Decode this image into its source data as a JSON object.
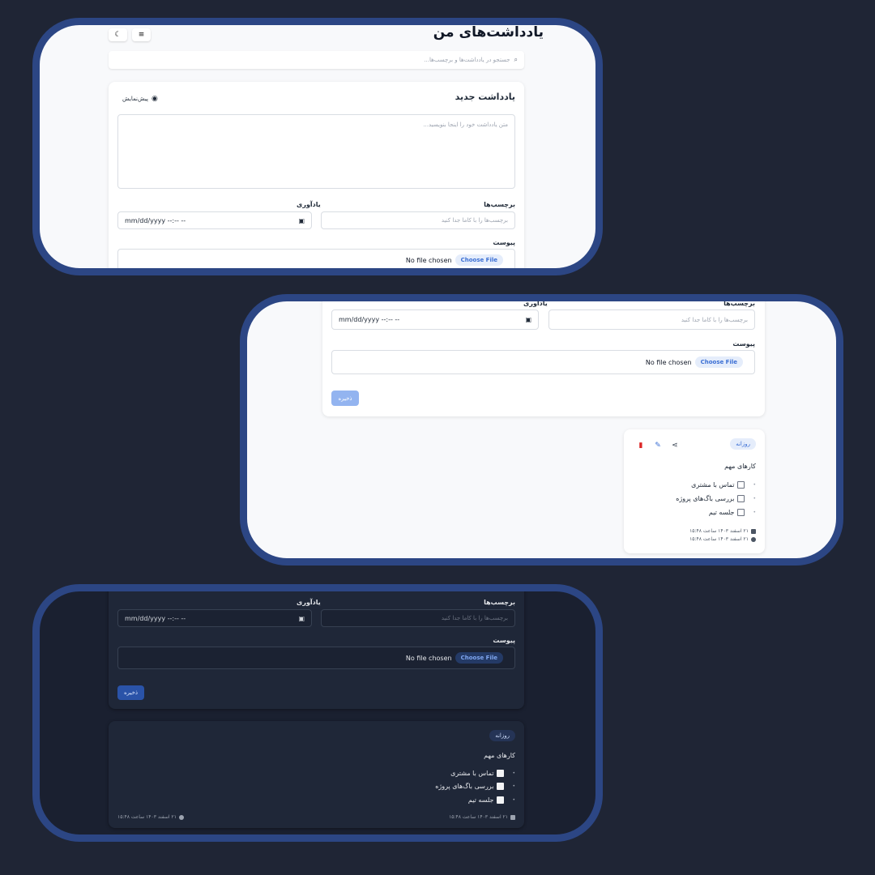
{
  "app": {
    "title": "یادداشت‌های من",
    "search_placeholder": "جستجو در یادداشت‌ها و برچسب‌ها..."
  },
  "editor": {
    "heading": "یادداشت جدید",
    "preview_label": "پیش‌نمایش",
    "content_placeholder": "متن یادداشت خود را اینجا بنویسید...",
    "tags_label": "برچسب‌ها",
    "tags_placeholder": "برچسب‌ها را با کاما جدا کنید",
    "reminder_label": "یادآوری",
    "reminder_value": "mm/dd/yyyy --:-- --",
    "attachment_label": "پیوست",
    "choose_file_label": "Choose File",
    "no_file_text": "No file chosen",
    "save_label": "ذخیره"
  },
  "note": {
    "tag": "روزانه",
    "title": "کارهای مهم",
    "tasks": [
      "تماس با مشتری",
      "بررسی باگ‌های پروژه",
      "جلسه تیم"
    ],
    "created": "۲۱ اسفند ۱۴۰۳ ساعت ۱۵:۴۸",
    "updated": "۲۱ اسفند ۱۴۰۳ ساعت ۱۵:۴۸"
  },
  "icons": {
    "theme_toggle": "moon-icon",
    "menu": "menu-icon",
    "search": "search-icon",
    "preview": "eye-icon",
    "calendar": "calendar-icon",
    "share": "share-icon",
    "edit": "pencil-icon",
    "delete": "trash-icon",
    "created": "calendar-icon",
    "updated": "clock-icon"
  },
  "colors": {
    "frame_border": "#2c4684",
    "background": "#1f2535",
    "accent": "#3b6fd4",
    "delete": "#dc2626"
  }
}
